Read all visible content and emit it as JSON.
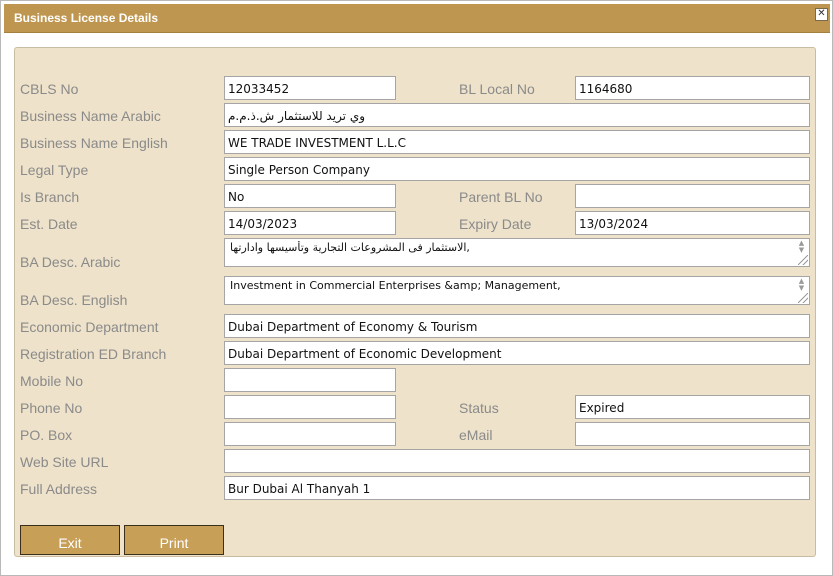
{
  "dialog": {
    "title": "Business License Details",
    "close_glyph": "✕"
  },
  "labels": {
    "cbls_no": "CBLS No",
    "bl_local_no": "BL Local No",
    "business_name_arabic": "Business Name Arabic",
    "business_name_english": "Business Name English",
    "legal_type": "Legal Type",
    "is_branch": "Is Branch",
    "parent_bl_no": "Parent BL No",
    "est_date": "Est. Date",
    "expiry_date": "Expiry Date",
    "ba_desc_arabic": "BA Desc. Arabic",
    "ba_desc_english": "BA Desc. English",
    "economic_department": "Economic Department",
    "registration_ed_branch": "Registration ED Branch",
    "mobile_no": "Mobile No",
    "phone_no": "Phone No",
    "status": "Status",
    "po_box": "PO. Box",
    "email": "eMail",
    "web_site_url": "Web Site URL",
    "full_address": "Full Address"
  },
  "values": {
    "cbls_no": "12033452",
    "bl_local_no": "1164680",
    "business_name_arabic": "وي تريد للاستثمار ش.ذ.م.م",
    "business_name_english": "WE TRADE INVESTMENT L.L.C",
    "legal_type": "Single Person Company",
    "is_branch": "No",
    "parent_bl_no": "",
    "est_date": "14/03/2023",
    "expiry_date": "13/03/2024",
    "ba_desc_arabic": "الاستثمار فى المشروعات  التجارية وتأسيسها وادارتها,",
    "ba_desc_english": "Investment in Commercial Enterprises &amp; Management,",
    "economic_department": "Dubai Department of Economy & Tourism",
    "registration_ed_branch": "Dubai Department of Economic Development",
    "mobile_no": "",
    "phone_no": "",
    "status": "Expired",
    "po_box": "",
    "email": "",
    "web_site_url": "",
    "full_address": "Bur Dubai Al Thanyah 1"
  },
  "buttons": {
    "exit": "Exit",
    "print": "Print"
  },
  "icons": {
    "close": "close-icon",
    "scroll_up": "scroll-up-icon",
    "scroll_down": "scroll-down-icon",
    "resize": "resize-grip-icon"
  },
  "colors": {
    "titlebar": "#bf9650",
    "panel": "#eee2ca",
    "button": "#c79f57"
  }
}
